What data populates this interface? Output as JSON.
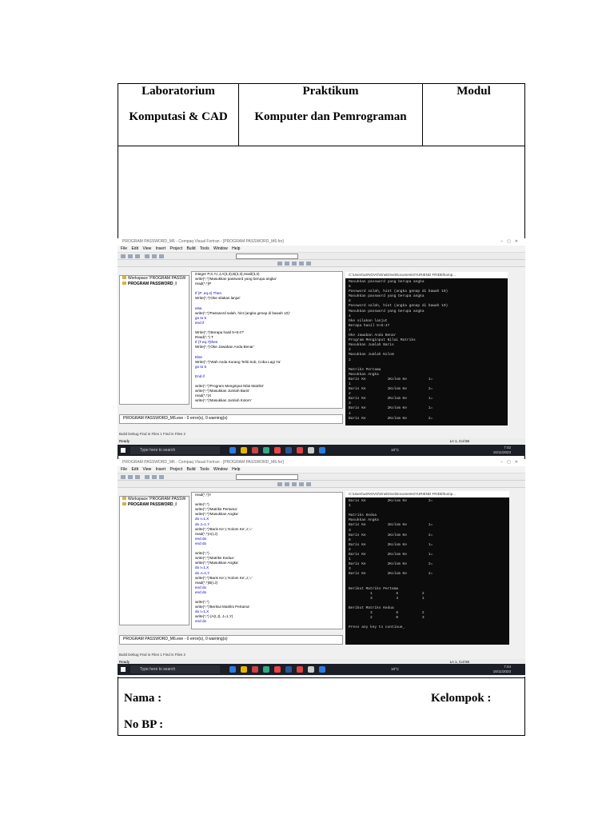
{
  "header": {
    "col1_line1": "Laboratorium",
    "col1_line2": "Komputasi & CAD",
    "col2_line1": "Praktikum",
    "col2_line2": "Komputer dan Pemrograman",
    "col3_line1": "Modul"
  },
  "footer": {
    "nama_label": "Nama   :",
    "nobp_label": "No BP  :",
    "kelompok_label": "Kelompok :"
  },
  "screenshots": [
    {
      "window_title": "PROGRAM PASSWORD_M6 - Compaq Visual Fortran - [PROGRAM PASSWORD_M6.for]",
      "menu": [
        "File",
        "Edit",
        "View",
        "Insert",
        "Project",
        "Build",
        "Tools",
        "Window",
        "Help"
      ],
      "workspace": [
        "Workspace 'PROGRAM PASSW",
        "PROGRAM PASSWORD_I"
      ],
      "code_lines": [
        "integer P,X,Y,I,J,A(3,3),B(3,3),Hasil(3,3)",
        "write(*,*)'Masukkan password yang berupa angka'",
        "read(*,*)P",
        "",
        "If (P .eq.4) Then",
        "Write(*,*)'Oke silakan lanjut'",
        "",
        "else",
        "write(*,*)'Password salah, hint (angka genap di bawah 10)'",
        "go to 5",
        "end if",
        "",
        "Write(*,*)'Berapa hasil 5+8:4?'",
        "Read(*,*) T",
        "If (T.eq.7)then",
        "Write(*,*)'Oke Jawaban Anda Benar'",
        "",
        "Else",
        "Write(*,*)'Wah Anda Kurang Teliti Sob, Coba Lagi Ya'",
        "go to 5",
        "",
        "End if",
        "",
        "write(*,*)'Program Menginput Nilai Matriks'",
        "write(*,*)'Masukkan Jumlah Baris'",
        "read(*,*)X",
        "write(*,*)'Masukkan Jumlah Kolom'"
      ],
      "console_title": "C:\\Users\\LENOVO\\OneDrive\\Documents\\YURIEND FRIDE\\komp...",
      "console_lines": [
        "Masukkan password yang berupa angka",
        "6",
        "Password salah, hint (angka genap di bawah 10)",
        "Masukkan password yang berupa angka",
        "8",
        "Password salah, hint (angka genap di bawah 10)",
        "Masukkan password yang berupa angka",
        "4",
        "Oke silakan lanjut",
        "Berapa hasil 5+8:4?",
        "7",
        "Oke Jawaban Anda Benar",
        "Program Menginput Nilai Matriks",
        "Masukkan Jumlah Baris",
        "2",
        "Masukkan Jumlah Kolom",
        "2",
        "",
        "Matriks Pertama",
        "Masukkan Angka",
        "Baris Ke          1Kolom Ke          1=",
        "1",
        "Baris Ke          1Kolom Ke          2=",
        "2",
        "Baris Ke          2Kolom Ke          1=",
        "3",
        "Baris Ke          2Kolom Ke          1=",
        "4",
        "Baris Ke          2Kolom Ke          2="
      ],
      "output_text": "PROGRAM PASSWORD_M6.exe - 0 error(s), 0 warning(s)",
      "tabs": "Build  Debug  Find in Files 1  Find in Files 2",
      "status": "Ready",
      "status_right": "Ln 1, Col 56",
      "search_text": "Type here to search",
      "temperature": "18°C",
      "clock": "7:42\n16/11/2023"
    },
    {
      "window_title": "PROGRAM PASSWORD_M6 - Compaq Visual Fortran - [PROGRAM PASSWORD_M6.for]",
      "menu": [
        "File",
        "Edit",
        "View",
        "Insert",
        "Project",
        "Build",
        "Tools",
        "Window",
        "Help"
      ],
      "workspace": [
        "Workspace 'PROGRAM PASSW",
        "PROGRAM PASSWORD_I"
      ],
      "code_lines": [
        "read(*,*)Y",
        "",
        "write(*,*)",
        "write(*,*)'Matriks Pertama'",
        "write(*,*)'Masukkan Angka'",
        "do I=1,X",
        "do J=1,Y",
        "write(*,*)'Baris Ke',I,'Kolom Ke',J,'='",
        "read(*,*)A(I,J)",
        "end do",
        "end do",
        "",
        "write(*,*)",
        "write(*,*)'Matriks Kedua'",
        "write(*,*)'Masukkan Angka'",
        "do I=1,X",
        "do J=1,Y",
        "write(*,*)'Baris Ke',I,'Kolom Ke',J,'='",
        "read(*,*)B(I,J)",
        "end do",
        "end do",
        "",
        "write(*,*)",
        "write(*,*)'Berikut Matriks Pertama'",
        "do I=1,X",
        "write(*,*) (A(I,J), J=1,Y)",
        "end do"
      ],
      "console_title": "C:\\Users\\LENOVO\\OneDrive\\Documents\\YURIEND FRIDE\\komp...",
      "console_lines": [
        "Baris Ke          2Kolom Ke          2=",
        "1",
        "",
        "Matriks Kedua",
        "Masukkan Angka",
        "Baris Ke          1Kolom Ke          1=",
        "3",
        "Baris Ke          1Kolom Ke          2=",
        "8",
        "Baris Ke          2Kolom Ke          1=",
        "2",
        "Baris Ke          2Kolom Ke          1=",
        "1",
        "Baris Ke          2Kolom Ke          2=",
        "3",
        "Baris Ke          2Kolom Ke          2=",
        "",
        "",
        "Berikut Matriks Pertama",
        "          1           8           2",
        "          3           4           1",
        "",
        "Berikut Matriks Kedua",
        "          3           8           2",
        "          2           0           3",
        "",
        "Press any key to continue_"
      ],
      "output_text": "PROGRAM PASSWORD_M6.exe - 0 error(s), 0 warning(s)",
      "tabs": "Build  Debug  Find in Files 1  Find in Files 2",
      "status": "Ready",
      "status_right": "Ln 1, Col 56",
      "search_text": "Type here to search",
      "temperature": "18°C",
      "clock": "7:44\n16/11/2023"
    }
  ]
}
